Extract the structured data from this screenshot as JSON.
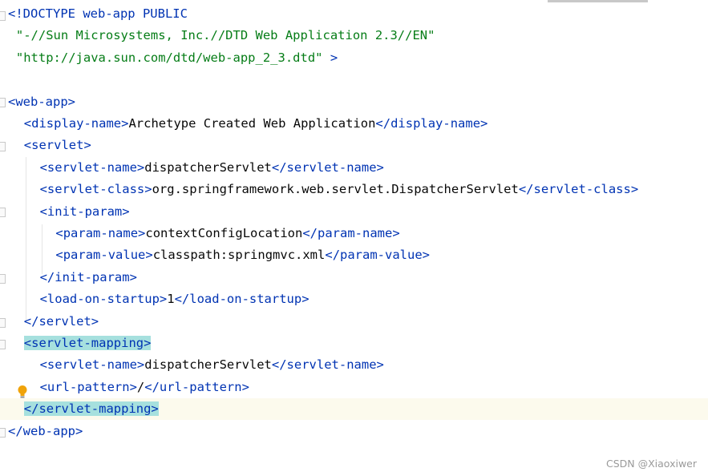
{
  "lines": [
    {
      "indent": "",
      "parts": [
        {
          "c": "tag",
          "t": "<!DOCTYPE web-app PUBLIC"
        }
      ]
    },
    {
      "indent": " ",
      "parts": [
        {
          "c": "str",
          "t": "\"-//Sun Microsystems, Inc.//DTD Web Application 2.3//EN\""
        }
      ]
    },
    {
      "indent": " ",
      "parts": [
        {
          "c": "str",
          "t": "\"http://java.sun.com/dtd/web-app_2_3.dtd\""
        },
        {
          "c": "tag",
          "t": " >"
        }
      ]
    },
    {
      "indent": "",
      "parts": []
    },
    {
      "indent": "",
      "parts": [
        {
          "c": "tag",
          "t": "<web-app>"
        }
      ]
    },
    {
      "indent": "  ",
      "parts": [
        {
          "c": "tag",
          "t": "<display-name>"
        },
        {
          "c": "txt",
          "t": "Archetype Created Web Application"
        },
        {
          "c": "tag",
          "t": "</display-name>"
        }
      ]
    },
    {
      "indent": "  ",
      "parts": [
        {
          "c": "tag",
          "t": "<servlet>"
        }
      ]
    },
    {
      "indent": "    ",
      "parts": [
        {
          "c": "tag",
          "t": "<servlet-name>"
        },
        {
          "c": "txt",
          "t": "dispatcherServlet"
        },
        {
          "c": "tag",
          "t": "</servlet-name>"
        }
      ]
    },
    {
      "indent": "    ",
      "parts": [
        {
          "c": "tag",
          "t": "<servlet-class>"
        },
        {
          "c": "txt",
          "t": "org.springframework.web.servlet.DispatcherServlet"
        },
        {
          "c": "tag",
          "t": "</servlet-class>"
        }
      ]
    },
    {
      "indent": "    ",
      "parts": [
        {
          "c": "tag",
          "t": "<init-param>"
        }
      ]
    },
    {
      "indent": "      ",
      "parts": [
        {
          "c": "tag",
          "t": "<param-name>"
        },
        {
          "c": "txt",
          "t": "contextConfigLocation"
        },
        {
          "c": "tag",
          "t": "</param-name>"
        }
      ]
    },
    {
      "indent": "      ",
      "parts": [
        {
          "c": "tag",
          "t": "<param-value>"
        },
        {
          "c": "txt",
          "t": "classpath:springmvc.xml"
        },
        {
          "c": "tag",
          "t": "</param-value>"
        }
      ]
    },
    {
      "indent": "    ",
      "parts": [
        {
          "c": "tag",
          "t": "</init-param>"
        }
      ]
    },
    {
      "indent": "    ",
      "parts": [
        {
          "c": "tag",
          "t": "<load-on-startup>"
        },
        {
          "c": "txt",
          "t": "1"
        },
        {
          "c": "tag",
          "t": "</load-on-startup>"
        }
      ]
    },
    {
      "indent": "  ",
      "parts": [
        {
          "c": "tag",
          "t": "</servlet>"
        }
      ]
    },
    {
      "indent": "  ",
      "parts": [
        {
          "c": "tag",
          "t": "<servlet-mapping>",
          "hl": true
        }
      ]
    },
    {
      "indent": "    ",
      "parts": [
        {
          "c": "tag",
          "t": "<servlet-name>"
        },
        {
          "c": "txt",
          "t": "dispatcherServlet"
        },
        {
          "c": "tag",
          "t": "</servlet-name>"
        }
      ]
    },
    {
      "indent": "    ",
      "parts": [
        {
          "c": "tag",
          "t": "<url-pattern>"
        },
        {
          "c": "txt",
          "t": "/"
        },
        {
          "c": "tag",
          "t": "</url-pattern>"
        }
      ]
    },
    {
      "indent": "  ",
      "current": true,
      "parts": [
        {
          "c": "tag",
          "t": "</servlet-mapping>",
          "hl": true
        }
      ]
    },
    {
      "indent": "",
      "parts": [
        {
          "c": "tag",
          "t": "</web-app>"
        }
      ]
    }
  ],
  "watermark": "CSDN @Xiaoxiwer",
  "colors": {
    "tag": "#0033b3",
    "string": "#067d17",
    "text": "#080808",
    "match_highlight": "#a6e0de",
    "current_line": "#fcfaed"
  },
  "icons": {
    "intention_bulb": "lightbulb-icon"
  }
}
